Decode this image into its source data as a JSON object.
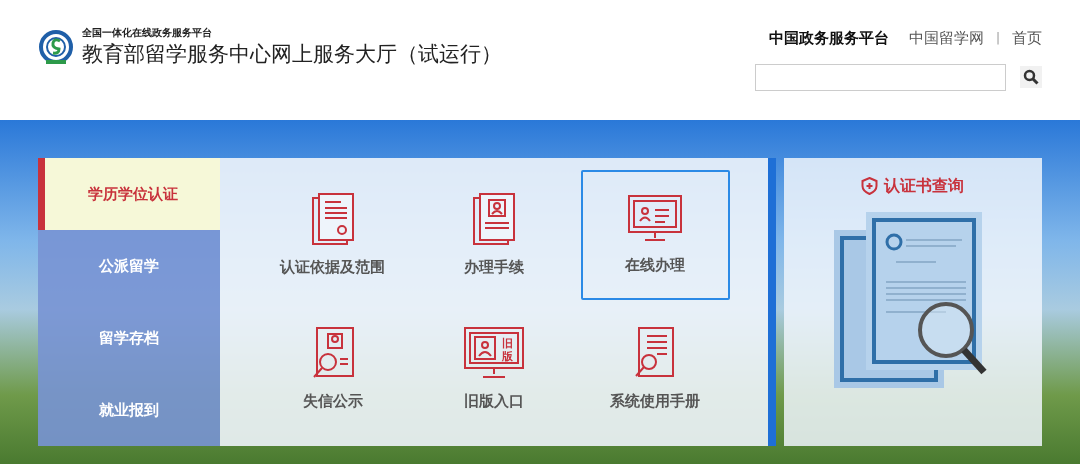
{
  "header": {
    "subtitle": "全国一体化在线政务服务平台",
    "title": "教育部留学服务中心网上服务大厅（试运行）",
    "links": [
      {
        "label": "中国政务服务平台",
        "kind": "strong"
      },
      {
        "label": "中国留学网",
        "kind": "plain"
      },
      {
        "label": "|",
        "kind": "separator"
      },
      {
        "label": "首页",
        "kind": "plain"
      }
    ]
  },
  "sidebar": {
    "items": [
      {
        "label": "学历学位认证",
        "selected": true
      },
      {
        "label": "公派留学",
        "selected": false
      },
      {
        "label": "留学存档",
        "selected": false
      },
      {
        "label": "就业报到",
        "selected": false
      }
    ]
  },
  "services": [
    {
      "label": "认证依据及范围",
      "kind": "document",
      "selected": false
    },
    {
      "label": "办理手续",
      "kind": "profile",
      "selected": false
    },
    {
      "label": "在线办理",
      "kind": "monitor",
      "selected": true
    },
    {
      "label": "失信公示",
      "kind": "search-profile",
      "selected": false
    },
    {
      "label": "旧版入口",
      "kind": "old-monitor",
      "badge": "旧版",
      "selected": false
    },
    {
      "label": "系统使用手册",
      "kind": "manual",
      "selected": false
    }
  ],
  "certificate_panel": {
    "title": "认证书查询"
  }
}
